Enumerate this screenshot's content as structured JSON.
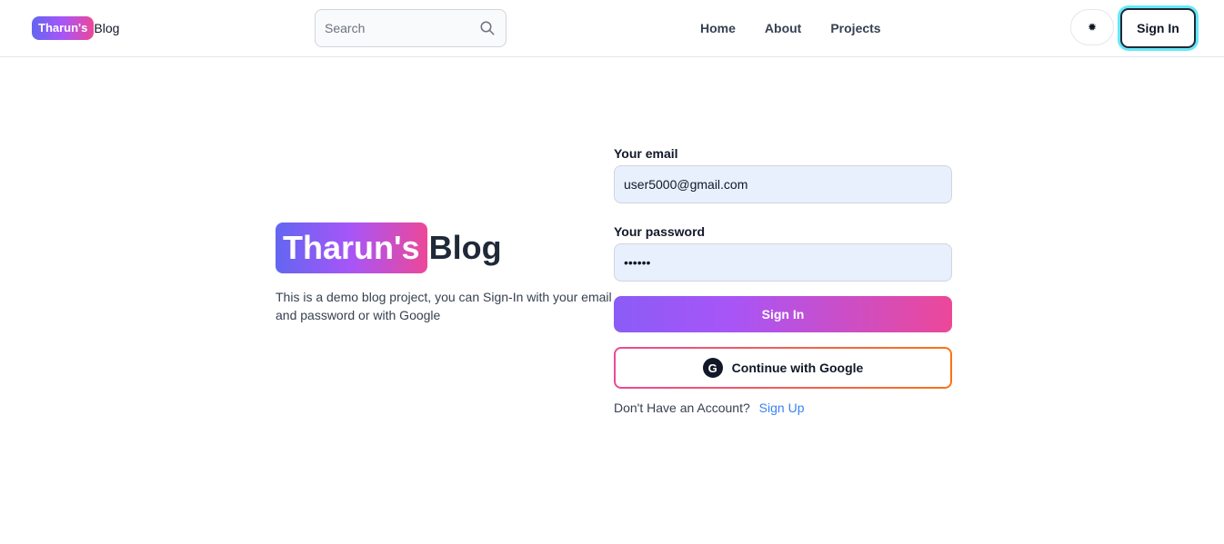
{
  "header": {
    "brand_badge": "Tharun's",
    "brand_word": "Blog",
    "search_placeholder": "Search",
    "nav": [
      "Home",
      "About",
      "Projects"
    ],
    "theme_icon": "sun-icon",
    "signin_label": "Sign In"
  },
  "hero": {
    "badge": "Tharun's",
    "word": "Blog",
    "description": "This is a demo blog project, you can Sign-In with your email and password or with Google"
  },
  "form": {
    "email_label": "Your email",
    "email_value": "user5000@gmail.com",
    "password_label": "Your password",
    "password_value": "••••••",
    "submit_label": "Sign In",
    "google_label": "Continue with Google",
    "google_icon": "google-icon",
    "no_account_text": "Don't Have an Account?",
    "signup_link": "Sign Up"
  },
  "colors": {
    "gradient_start": "#6366f1",
    "gradient_mid": "#a855f7",
    "gradient_end": "#ec4899",
    "link": "#3b82f6",
    "field_bg": "#e8f0fe",
    "focus_ring": "#67e8f9"
  }
}
